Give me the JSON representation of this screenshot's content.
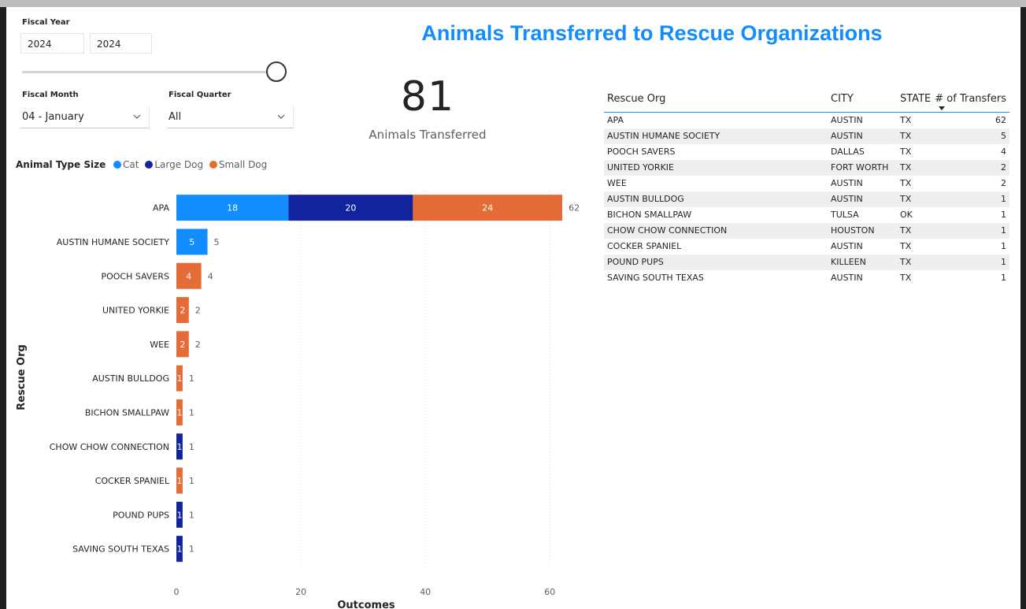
{
  "title": "Animals Transferred to Rescue Organizations",
  "fiscal_year": {
    "label": "Fiscal Year",
    "from": "2024",
    "to": "2024"
  },
  "fiscal_month": {
    "label": "Fiscal Month",
    "value": "04 - January"
  },
  "fiscal_quarter": {
    "label": "Fiscal Quarter",
    "value": "All"
  },
  "kpi": {
    "value": "81",
    "label": "Animals Transferred"
  },
  "colors": {
    "cat": "#118dff",
    "large_dog": "#12239e",
    "small_dog": "#e66c37",
    "title": "#118dff"
  },
  "chart_data": {
    "type": "bar",
    "orientation": "horizontal",
    "stacked": true,
    "legend_title": "Animal Type Size",
    "legend_placement": "top-left",
    "xlabel": "Outcomes",
    "ylabel": "Rescue Org",
    "xlim": [
      0,
      62
    ],
    "xticks": [
      0,
      20,
      40,
      60
    ],
    "grid": true,
    "categories": [
      "APA",
      "AUSTIN HUMANE SOCIETY",
      "POOCH SAVERS",
      "UNITED YORKIE",
      "WEE",
      "AUSTIN BULLDOG",
      "BICHON SMALLPAW",
      "CHOW CHOW CONNECTION",
      "COCKER SPANIEL",
      "POUND PUPS",
      "SAVING SOUTH TEXAS"
    ],
    "series": [
      {
        "name": "Cat",
        "values": [
          18,
          5,
          0,
          0,
          0,
          0,
          0,
          0,
          0,
          0,
          0
        ]
      },
      {
        "name": "Large Dog",
        "values": [
          20,
          0,
          0,
          0,
          0,
          0,
          0,
          1,
          0,
          1,
          1
        ]
      },
      {
        "name": "Small Dog",
        "values": [
          24,
          0,
          4,
          2,
          2,
          1,
          1,
          0,
          1,
          0,
          0
        ]
      }
    ],
    "totals": [
      62,
      5,
      4,
      2,
      2,
      1,
      1,
      1,
      1,
      1,
      1
    ]
  },
  "table": {
    "headers": [
      "Rescue Org",
      "CITY",
      "STATE",
      "# of Transfers"
    ],
    "rows": [
      [
        "APA",
        "AUSTIN",
        "TX",
        "62"
      ],
      [
        "AUSTIN HUMANE SOCIETY",
        "AUSTIN",
        "TX",
        "5"
      ],
      [
        "POOCH SAVERS",
        "DALLAS",
        "TX",
        "4"
      ],
      [
        "UNITED YORKIE",
        "FORT WORTH",
        "TX",
        "2"
      ],
      [
        "WEE",
        "AUSTIN",
        "TX",
        "2"
      ],
      [
        "AUSTIN BULLDOG",
        "AUSTIN",
        "TX",
        "1"
      ],
      [
        "BICHON SMALLPAW",
        "TULSA",
        "OK",
        "1"
      ],
      [
        "CHOW CHOW CONNECTION",
        "HOUSTON",
        "TX",
        "1"
      ],
      [
        "COCKER SPANIEL",
        "AUSTIN",
        "TX",
        "1"
      ],
      [
        "POUND PUPS",
        "KILLEEN",
        "TX",
        "1"
      ],
      [
        "SAVING SOUTH TEXAS",
        "AUSTIN",
        "TX",
        "1"
      ]
    ]
  }
}
